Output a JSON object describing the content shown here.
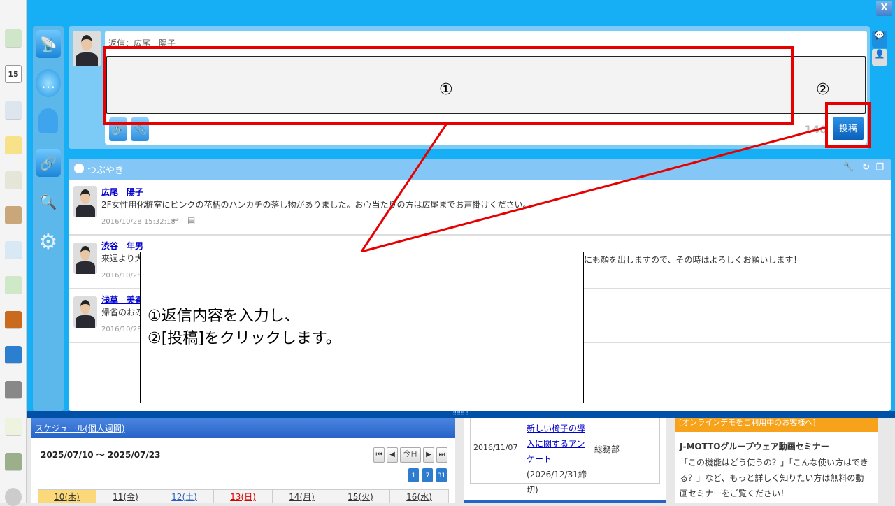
{
  "window": {
    "close_label": "X"
  },
  "compose": {
    "reply_label": "返信：広尾　陽子",
    "input_value": "",
    "counter": "140",
    "post_label": "投稿"
  },
  "feed": {
    "title": "つぶやき",
    "items": [
      {
        "name": "広尾　陽子",
        "text": "2F女性用化粧室にピンクの花柄のハンカチの落し物がありました。お心当たりの方は広尾までお声掛けください。",
        "time": "2016/10/28 15:32:18"
      },
      {
        "name": "渋谷　年男",
        "text": "来週より大",
        "text_tail": "にも顔を出しますので、その時はよろしくお願いします！",
        "time": "2016/10/28"
      },
      {
        "name": "浅草　美香",
        "text": "帰省のおみ",
        "time": "2016/10/28"
      }
    ]
  },
  "annotation": {
    "mark1": "①",
    "mark2": "②",
    "line1": "①返信内容を入力し、",
    "line2": "②[投稿]をクリックします。",
    "colors": {
      "highlight": "#e60000"
    }
  },
  "schedule": {
    "title": "スケジュール(個人週間)",
    "range": "2025/07/10 ～ 2025/07/23",
    "today_label": "今日",
    "nav": [
      "⏮",
      "◀",
      "▶",
      "⏭"
    ],
    "cal_icons": [
      "1",
      "7",
      "31"
    ],
    "days": [
      "10(木)",
      "11(金)",
      "12(土)",
      "13(日)",
      "14(月)",
      "15(火)",
      "16(水)"
    ]
  },
  "survey": {
    "date": "2016/11/07",
    "title": "新しい椅子の導入に関するアンケート",
    "suffix": "(2026/12/31締切)",
    "dept": "総務部"
  },
  "notice": {
    "header": "[オンラインデモをご利用中のお客様へ]",
    "title": "J-MOTTOグループウェア動画セミナー",
    "body": "「この機能はどう使うの？」「こんな使い方はできる？」など、もっと詳しく知りたい方は無料の動画セミナーをご覧ください！"
  },
  "leftbar": {
    "calendar_day": "15"
  }
}
